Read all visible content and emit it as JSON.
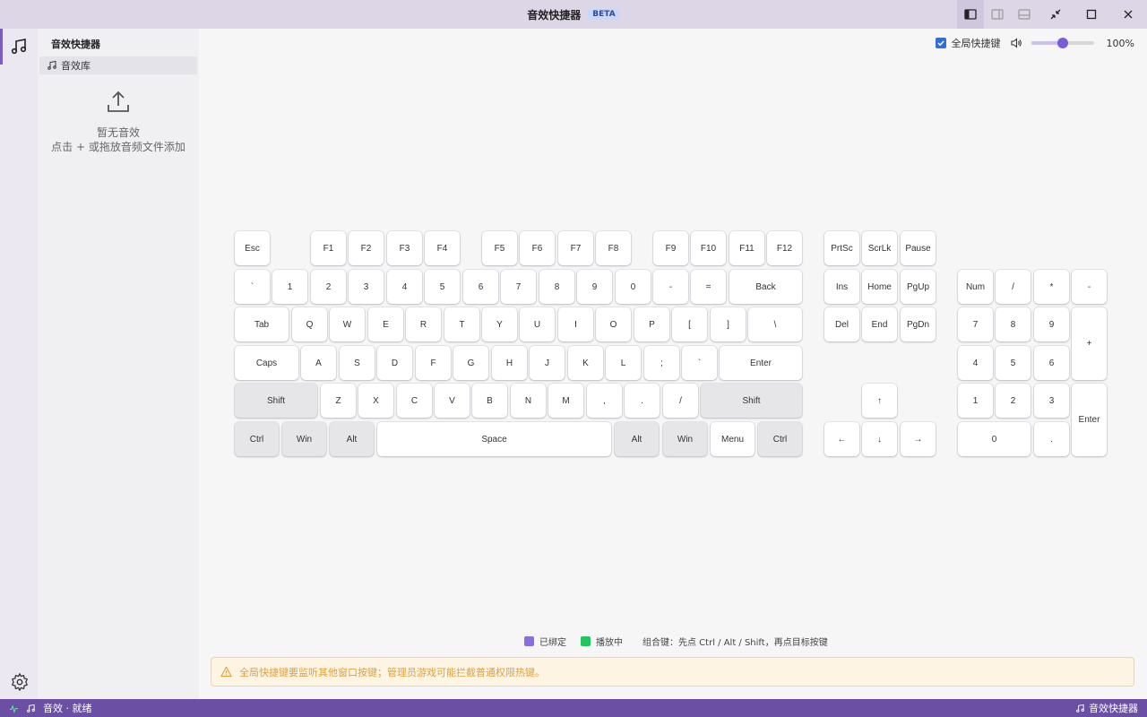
{
  "window": {
    "title": "音效快捷器",
    "badge": "BETA"
  },
  "sidebar": {
    "header": "音效快捷器",
    "items": [
      {
        "label": "音效库",
        "icon": "music-note-icon"
      }
    ],
    "empty_title": "暂无音效",
    "empty_hint": "点击 + 或拖放音频文件添加"
  },
  "controls": {
    "global_hotkey_label": "全局快捷键",
    "global_hotkey_checked": true,
    "volume_percent": 100,
    "volume_label": "100%"
  },
  "keyboard": {
    "main_rows": [
      [
        "Esc",
        "F1",
        "F2",
        "F3",
        "F4",
        "F5",
        "F6",
        "F7",
        "F8",
        "F9",
        "F10",
        "F11",
        "F12"
      ],
      [
        "`",
        "1",
        "2",
        "3",
        "4",
        "5",
        "6",
        "7",
        "8",
        "9",
        "0",
        "-",
        "=",
        "Back"
      ],
      [
        "Tab",
        "Q",
        "W",
        "E",
        "R",
        "T",
        "Y",
        "U",
        "I",
        "O",
        "P",
        "[",
        "]",
        "\\"
      ],
      [
        "Caps",
        "A",
        "S",
        "D",
        "F",
        "G",
        "H",
        "J",
        "K",
        "L",
        ";",
        "`",
        "Enter"
      ],
      [
        "Shift",
        "Z",
        "X",
        "C",
        "V",
        "B",
        "N",
        "M",
        ",",
        ".",
        "/",
        "Shift"
      ],
      [
        "Ctrl",
        "Win",
        "Alt",
        "Space",
        "Alt",
        "Win",
        "Menu",
        "Ctrl"
      ]
    ],
    "nav_keys": [
      "PrtSc",
      "ScrLk",
      "Pause",
      "Ins",
      "Home",
      "PgUp",
      "Del",
      "End",
      "PgDn",
      "↑",
      "←",
      "↓",
      "→"
    ],
    "numpad_keys": [
      "Num",
      "/",
      "*",
      "-",
      "7",
      "8",
      "9",
      "+",
      "4",
      "5",
      "6",
      "1",
      "2",
      "3",
      "Enter",
      "0",
      "."
    ]
  },
  "legend": {
    "bound_label": "已绑定",
    "bound_color": "#8b6fe0",
    "playing_label": "播放中",
    "playing_color": "#22c55e",
    "combo_hint": "组合键：先点 Ctrl / Alt / Shift，再点目标按键"
  },
  "warning": {
    "text": "全局快捷键要监听其他窗口按键；管理员游戏可能拦截普通权限热键。"
  },
  "statusbar": {
    "left_text": "音效 · 就绪",
    "right_text": "音效快捷器"
  },
  "colors": {
    "accent": "#7a5cc5",
    "statusbar": "#6b4fa5",
    "titlebar": "#dcd6e6",
    "warning_text": "#e0a13c"
  }
}
